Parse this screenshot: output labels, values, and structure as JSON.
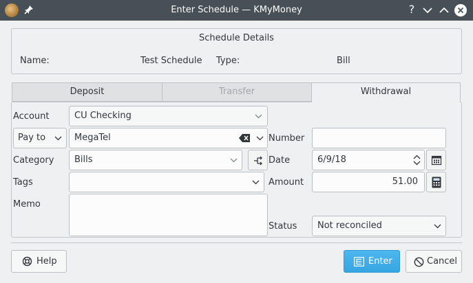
{
  "window": {
    "title": "Enter Schedule — KMyMoney"
  },
  "titlebar_buttons": {
    "help": "?"
  },
  "details": {
    "heading": "Schedule Details",
    "name_label": "Name:",
    "name_value": "Test Schedule",
    "type_label": "Type:",
    "type_value": "Bill"
  },
  "tabs": [
    {
      "label": "Deposit",
      "state": "normal"
    },
    {
      "label": "Transfer",
      "state": "disabled"
    },
    {
      "label": "Withdrawal",
      "state": "active"
    }
  ],
  "form": {
    "account_label": "Account",
    "account_value": "CU Checking",
    "payto_selector": "Pay to",
    "payee_value": "MegaTel",
    "number_label": "Number",
    "number_value": "",
    "category_label": "Category",
    "category_value": "Bills",
    "date_label": "Date",
    "date_value": "6/9/18",
    "tags_label": "Tags",
    "tags_value": "",
    "amount_label": "Amount",
    "amount_value": "51.00",
    "memo_label": "Memo",
    "memo_value": "",
    "status_label": "Status",
    "status_value": "Not reconciled"
  },
  "buttons": {
    "help": "Help",
    "enter": "Enter",
    "cancel": "Cancel"
  },
  "colors": {
    "accent": "#3daee9",
    "titlebar": "#475057",
    "background": "#eff0f1"
  }
}
